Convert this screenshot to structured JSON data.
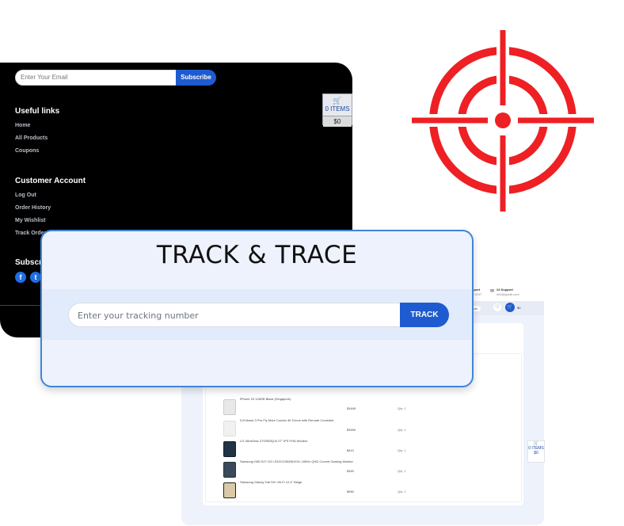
{
  "footer": {
    "newsletter_placeholder": "Enter Your Email",
    "subscribe_label": "Subscribe",
    "useful_links_heading": "Useful links",
    "useful_links": [
      "Home",
      "All Products",
      "Coupons"
    ],
    "customer_account_heading": "Customer Account",
    "account_links": [
      "Log Out",
      "Order History",
      "My Wishlist",
      "Track Order"
    ],
    "subscribe_heading": "Subscri"
  },
  "cart_widget": {
    "items": "0 ITEMS",
    "total": "$0"
  },
  "back_cart_widget": {
    "items": "0 ITEMS",
    "total": "$0"
  },
  "back_page": {
    "support_1_title": "pport",
    "support_1_value": "...0107",
    "support_2_title": "24 Support",
    "support_2_value": "info@gmail.com",
    "search_tail": "Mon",
    "cart_badge": "$0",
    "products": [
      {
        "name": "iPhone 15 128GB Black (Singapore)",
        "price": "$1649",
        "qty": "Qty: 1"
      },
      {
        "name": "DJI Mavic 3 Pro Fly More Combo 4K Drone with Remote Controller",
        "price": "$3000",
        "qty": "Qty: 1"
      },
      {
        "name": "LG UltraGear 27GR83Q-B 27\" IPS FHD Monitor",
        "price": "$410",
        "qty": "Qty: 1"
      },
      {
        "name": "Samsung G85 S27 G3 LS32CG302NHXXL 165Hz QHD Curved Gaming Monitor",
        "price": "$340",
        "qty": "Qty: 1"
      },
      {
        "name": "Samsung Galaxy Tab S9+ Wi-Fi 12.4\" Beige",
        "price": "$950",
        "qty": "Qty: 1"
      }
    ]
  },
  "track": {
    "title": "TRACK & TRACE",
    "input_placeholder": "Enter your tracking number",
    "button_label": "TRACK"
  },
  "colors": {
    "accent": "#1f5bd0",
    "target_red": "#ee2024",
    "card_border": "#3e86da"
  },
  "icons": [
    "cart-icon",
    "facebook-icon",
    "twitter-icon",
    "target-crosshair-icon",
    "heart-icon",
    "mail-icon"
  ]
}
